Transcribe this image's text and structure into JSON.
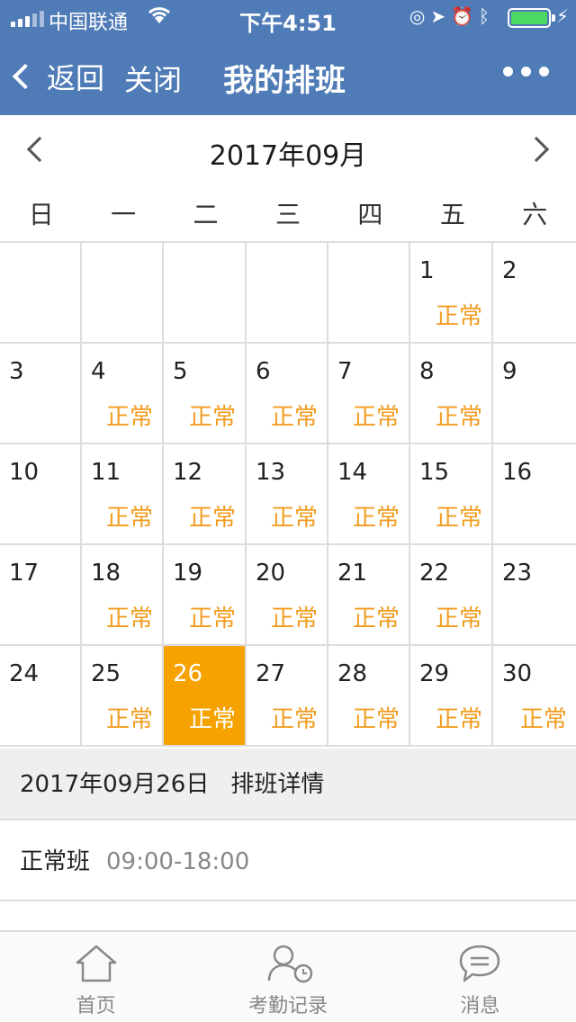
{
  "status_bar": {
    "carrier": "中国联通",
    "time": "下午4:51"
  },
  "nav": {
    "back_label": "返回",
    "close_label": "关闭",
    "title": "我的排班"
  },
  "calendar": {
    "month_label": "2017年09月",
    "weekdays": [
      "日",
      "一",
      "二",
      "三",
      "四",
      "五",
      "六"
    ],
    "weeks": [
      [
        {
          "day": "",
          "shift": ""
        },
        {
          "day": "",
          "shift": ""
        },
        {
          "day": "",
          "shift": ""
        },
        {
          "day": "",
          "shift": ""
        },
        {
          "day": "",
          "shift": ""
        },
        {
          "day": "1",
          "shift": "正常"
        },
        {
          "day": "2",
          "shift": ""
        }
      ],
      [
        {
          "day": "3",
          "shift": ""
        },
        {
          "day": "4",
          "shift": "正常"
        },
        {
          "day": "5",
          "shift": "正常"
        },
        {
          "day": "6",
          "shift": "正常"
        },
        {
          "day": "7",
          "shift": "正常"
        },
        {
          "day": "8",
          "shift": "正常"
        },
        {
          "day": "9",
          "shift": ""
        }
      ],
      [
        {
          "day": "10",
          "shift": ""
        },
        {
          "day": "11",
          "shift": "正常"
        },
        {
          "day": "12",
          "shift": "正常"
        },
        {
          "day": "13",
          "shift": "正常"
        },
        {
          "day": "14",
          "shift": "正常"
        },
        {
          "day": "15",
          "shift": "正常"
        },
        {
          "day": "16",
          "shift": ""
        }
      ],
      [
        {
          "day": "17",
          "shift": ""
        },
        {
          "day": "18",
          "shift": "正常"
        },
        {
          "day": "19",
          "shift": "正常"
        },
        {
          "day": "20",
          "shift": "正常"
        },
        {
          "day": "21",
          "shift": "正常"
        },
        {
          "day": "22",
          "shift": "正常"
        },
        {
          "day": "23",
          "shift": ""
        }
      ],
      [
        {
          "day": "24",
          "shift": ""
        },
        {
          "day": "25",
          "shift": "正常"
        },
        {
          "day": "26",
          "shift": "正常",
          "selected": true
        },
        {
          "day": "27",
          "shift": "正常"
        },
        {
          "day": "28",
          "shift": "正常"
        },
        {
          "day": "29",
          "shift": "正常"
        },
        {
          "day": "30",
          "shift": "正常"
        }
      ]
    ]
  },
  "detail": {
    "date": "2017年09月26日",
    "heading": "排班详情",
    "shift_type": "正常班",
    "shift_time": "09:00-18:00"
  },
  "tabbar": {
    "items": [
      {
        "label": "首页",
        "icon": "home-icon"
      },
      {
        "label": "考勤记录",
        "icon": "attendance-record-icon"
      },
      {
        "label": "消息",
        "icon": "message-icon"
      }
    ]
  },
  "colors": {
    "header_bg": "#4f7bb7",
    "shift_text": "#f29c1f",
    "selected_bg": "#f6a200"
  }
}
